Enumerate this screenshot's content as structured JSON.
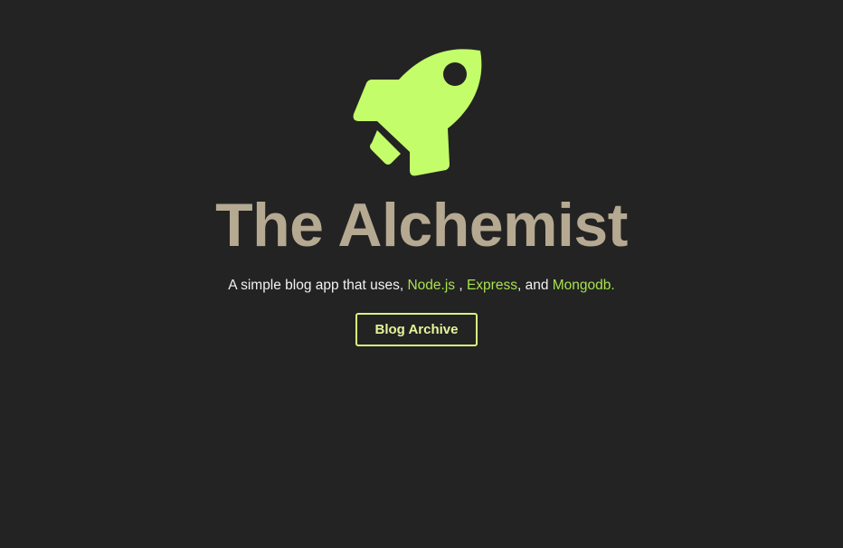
{
  "logo": {
    "icon": "rocket-icon",
    "color": "#c4fd6a"
  },
  "hero": {
    "title": "The Alchemist",
    "tagline_prefix": "A simple blog app that uses, ",
    "link_node": "Node.js",
    "sep_1": " , ",
    "link_express": "Express",
    "sep_2": ", and ",
    "link_mongodb": "Mongodb."
  },
  "button": {
    "label": "Blog Archive"
  },
  "colors": {
    "background": "#232323",
    "title": "#b5a992",
    "link": "#a6e14e",
    "button_border": "#d8f37f"
  }
}
